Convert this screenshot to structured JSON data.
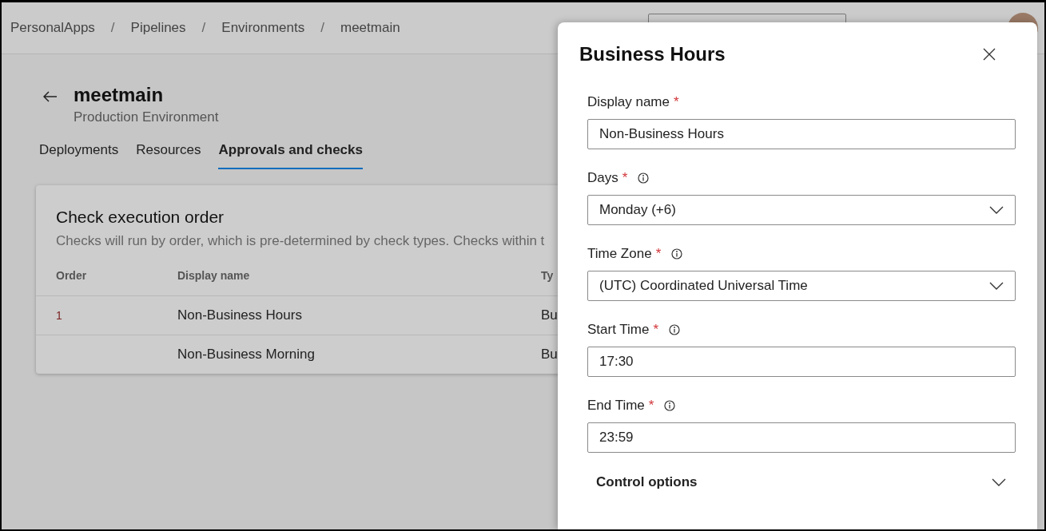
{
  "breadcrumb": [
    {
      "kind": "link",
      "text": "PersonalApps"
    },
    {
      "kind": "separator",
      "text": "/"
    },
    {
      "kind": "link",
      "text": "Pipelines"
    },
    {
      "kind": "separator",
      "text": "/"
    },
    {
      "kind": "link",
      "text": "Environments"
    },
    {
      "kind": "separator",
      "text": "/"
    },
    {
      "kind": "link",
      "text": "meetmain"
    }
  ],
  "page": {
    "title": "meetmain",
    "subtitle": "Production Environment",
    "tabs": [
      {
        "label": "Deployments",
        "selected": false
      },
      {
        "label": "Resources",
        "selected": false
      },
      {
        "label": "Approvals and checks",
        "selected": true
      }
    ]
  },
  "card": {
    "title": "Check execution order",
    "description": "Checks will run by order, which is pre-determined by check types. Checks within t",
    "columns": [
      "Order",
      "Display name",
      "Ty"
    ],
    "rows": [
      [
        "1",
        "Non-Business Hours",
        "Bu"
      ],
      [
        "",
        "Non-Business Morning",
        "Bu"
      ]
    ]
  },
  "panel": {
    "title": "Business Hours",
    "fields": [
      {
        "kind": "text",
        "label": "Display name",
        "required_mark": "*",
        "info": false,
        "value": "Non-Business Hours"
      },
      {
        "kind": "dropdown",
        "label": "Days",
        "required_mark": "*",
        "info": true,
        "value": "Monday (+6)"
      },
      {
        "kind": "dropdown",
        "label": "Time Zone",
        "required_mark": "*",
        "info": true,
        "value": "(UTC) Coordinated Universal Time"
      },
      {
        "kind": "text",
        "label": "Start Time",
        "required_mark": "*",
        "info": true,
        "value": "17:30"
      },
      {
        "kind": "text",
        "label": "End Time",
        "required_mark": "*",
        "info": true,
        "value": "23:59"
      }
    ],
    "control_options": {
      "title": "Control options",
      "expanded": false
    }
  }
}
